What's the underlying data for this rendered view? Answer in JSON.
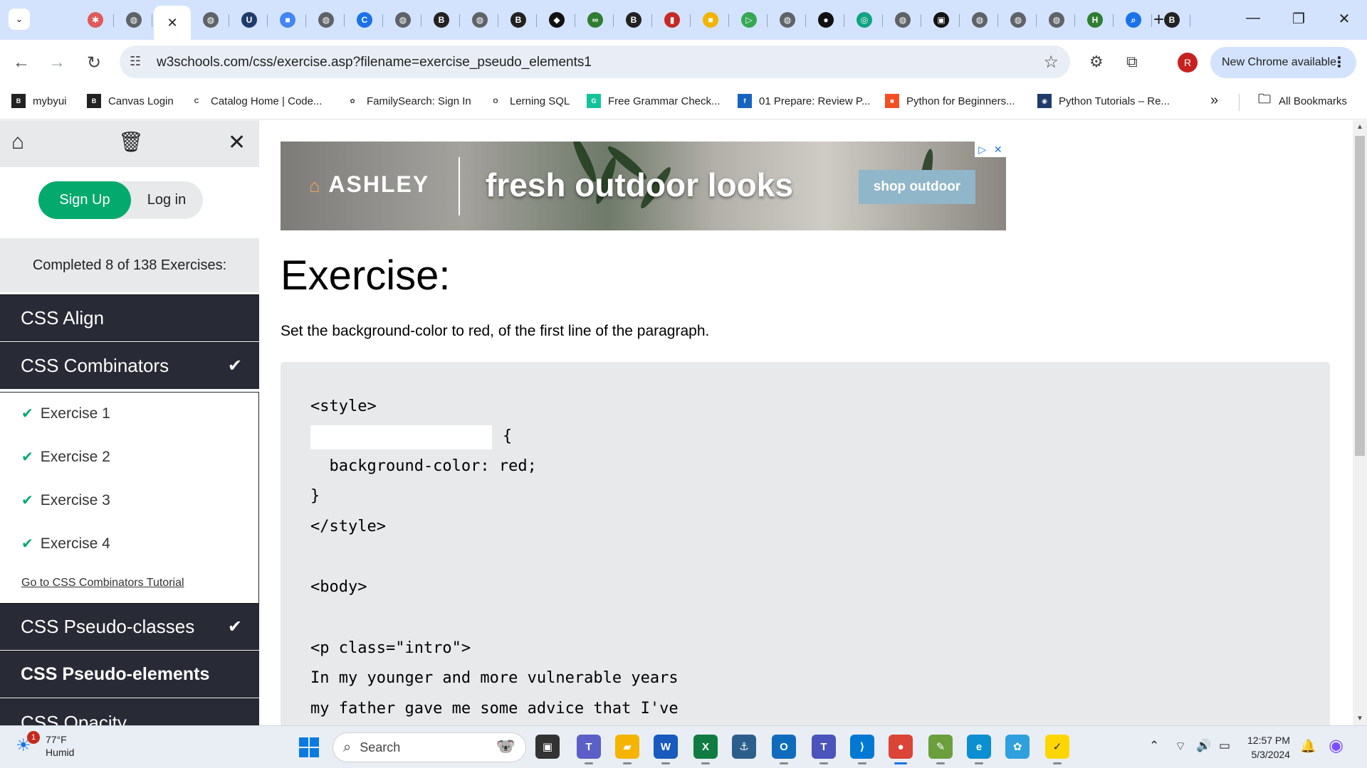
{
  "browser": {
    "tabs": [
      {
        "name": "tab-favicon",
        "color": "#e05a5a",
        "glyph": "✱"
      },
      {
        "name": "tab-globe",
        "color": "#5f6368",
        "glyph": "◍"
      },
      {
        "name": "tab-globe",
        "color": "#5f6368",
        "glyph": "◍"
      },
      {
        "name": "tab-byu",
        "color": "#1f3b6b",
        "glyph": "U"
      },
      {
        "name": "tab-colorful",
        "color": "#4285f4",
        "glyph": "■"
      },
      {
        "name": "tab-globe",
        "color": "#5f6368",
        "glyph": "◍"
      },
      {
        "name": "tab-blue-c",
        "color": "#1a73e8",
        "glyph": "C"
      },
      {
        "name": "tab-globe",
        "color": "#5f6368",
        "glyph": "◍"
      },
      {
        "name": "tab-byu",
        "color": "#222222",
        "glyph": "B"
      },
      {
        "name": "tab-globe",
        "color": "#5f6368",
        "glyph": "◍"
      },
      {
        "name": "tab-byu",
        "color": "#222222",
        "glyph": "B"
      },
      {
        "name": "tab-codepen",
        "color": "#111111",
        "glyph": "◆"
      },
      {
        "name": "tab-green",
        "color": "#2e7d32",
        "glyph": "∞"
      },
      {
        "name": "tab-byu",
        "color": "#222222",
        "glyph": "B"
      },
      {
        "name": "tab-red",
        "color": "#c62828",
        "glyph": "▮"
      },
      {
        "name": "tab-colorful",
        "color": "#f4b400",
        "glyph": "■"
      },
      {
        "name": "tab-green-play",
        "color": "#34a853",
        "glyph": "▷"
      },
      {
        "name": "tab-globe",
        "color": "#5f6368",
        "glyph": "◍"
      },
      {
        "name": "tab-github",
        "color": "#111111",
        "glyph": "●"
      },
      {
        "name": "tab-chatgpt",
        "color": "#10a37f",
        "glyph": "◎"
      },
      {
        "name": "tab-globe",
        "color": "#5f6368",
        "glyph": "◍"
      },
      {
        "name": "tab-dark",
        "color": "#111111",
        "glyph": "▣"
      },
      {
        "name": "tab-globe",
        "color": "#5f6368",
        "glyph": "◍"
      },
      {
        "name": "tab-globe",
        "color": "#5f6368",
        "glyph": "◍"
      },
      {
        "name": "tab-globe",
        "color": "#5f6368",
        "glyph": "◍"
      },
      {
        "name": "tab-h",
        "color": "#2e7d32",
        "glyph": "H"
      },
      {
        "name": "tab-search",
        "color": "#1a73e8",
        "glyph": "⌕"
      },
      {
        "name": "tab-byu",
        "color": "#222222",
        "glyph": "B"
      }
    ],
    "active_tab_close": "✕",
    "url": "w3schools.com/css/exercise.asp?filename=exercise_pseudo_elements1",
    "profile_initial": "R",
    "update_label": "New Chrome available",
    "bookmarks": [
      {
        "label": "mybyui",
        "color": "#222222",
        "glyph": "B"
      },
      {
        "label": "Canvas Login",
        "color": "#222222",
        "glyph": "B"
      },
      {
        "label": "Catalog Home | Code...",
        "color": "#ffffff",
        "glyph": "C"
      },
      {
        "label": "FamilySearch: Sign In",
        "color": "#ffffff",
        "glyph": "✿"
      },
      {
        "label": "Lerning SQL",
        "color": "#ffffff",
        "glyph": "O"
      },
      {
        "label": "Free Grammar Check...",
        "color": "#15c39a",
        "glyph": "G"
      },
      {
        "label": "01 Prepare: Review P...",
        "color": "#1565c0",
        "glyph": "f"
      },
      {
        "label": "Python for Beginners...",
        "color": "#f25022",
        "glyph": "■"
      },
      {
        "label": "Python Tutorials – Re...",
        "color": "#1f3b6b",
        "glyph": "◉"
      }
    ],
    "bookmarks_overflow": "»",
    "all_bookmarks": "All Bookmarks"
  },
  "sidebar": {
    "signup": "Sign Up",
    "login": "Log in",
    "progress": "Completed 8 of 138 Exercises:",
    "topics_top": [
      {
        "label": "CSS Align",
        "done": false
      },
      {
        "label": "CSS Combinators",
        "done": true
      }
    ],
    "exercises": [
      "Exercise 1",
      "Exercise 2",
      "Exercise 3",
      "Exercise 4"
    ],
    "tutorial_link": "Go to CSS Combinators Tutorial",
    "topics_bottom": [
      {
        "label": "CSS Pseudo-classes",
        "done": true
      },
      {
        "label": "CSS Pseudo-elements",
        "done": false
      },
      {
        "label": "CSS Opacity",
        "done": false
      }
    ]
  },
  "ad": {
    "brand": "ASHLEY",
    "tagline": "fresh outdoor looks",
    "cta": "shop outdoor"
  },
  "exercise": {
    "title": "Exercise:",
    "instruction": "Set the background-color to red, of the first line of the paragraph.",
    "code_lines": [
      "<style>",
      "{",
      "  background-color: red;",
      "}",
      "</style>",
      "",
      "<body>",
      "",
      "<p class=\"intro\">",
      "In my younger and more vulnerable years",
      "my father gave me some advice that I've"
    ]
  },
  "taskbar": {
    "temperature": "77°F",
    "condition": "Humid",
    "weather_badge": "1",
    "search_placeholder": "Search",
    "time": "12:57 PM",
    "date": "5/3/2024",
    "apps": [
      {
        "name": "task-view",
        "color": "#333333",
        "glyph": "▣"
      },
      {
        "name": "teams",
        "color": "#5b5fc7",
        "glyph": "T"
      },
      {
        "name": "file-explorer",
        "color": "#f4b400",
        "glyph": "▰"
      },
      {
        "name": "word",
        "color": "#185abd",
        "glyph": "W"
      },
      {
        "name": "excel",
        "color": "#107c41",
        "glyph": "X"
      },
      {
        "name": "mysql-workbench",
        "color": "#2c5e8c",
        "glyph": "⚓"
      },
      {
        "name": "outlook",
        "color": "#0f6cbd",
        "glyph": "O"
      },
      {
        "name": "teams-new",
        "color": "#4b53bc",
        "glyph": "T"
      },
      {
        "name": "vscode",
        "color": "#0078d4",
        "glyph": "⟩"
      },
      {
        "name": "chrome",
        "color": "#db4437",
        "glyph": "●"
      },
      {
        "name": "notepad",
        "color": "#6a9f3c",
        "glyph": "✎"
      },
      {
        "name": "edge",
        "color": "#0c8fd0",
        "glyph": "e"
      },
      {
        "name": "paint",
        "color": "#2fa0de",
        "glyph": "✿"
      },
      {
        "name": "norton",
        "color": "#ffd600",
        "glyph": "✓"
      }
    ]
  }
}
